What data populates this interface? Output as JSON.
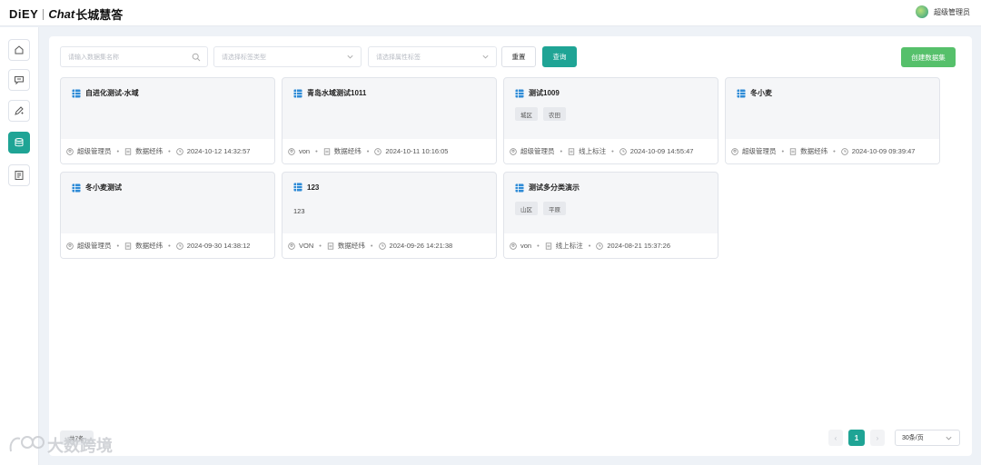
{
  "app": {
    "logo_brand": "DiEY",
    "logo_chat": "Chat",
    "logo_cn": "长城慧答",
    "user_name": "超级管理员"
  },
  "filters": {
    "search_placeholder": "请输入数据集名称",
    "type_placeholder": "请选择标签类型",
    "attr_placeholder": "请选择属性标签",
    "reset_label": "重置",
    "query_label": "查询",
    "create_label": "创建数据集"
  },
  "cards": [
    {
      "title": "自进化测试-水域",
      "desc": "",
      "tags": [],
      "user": "超级管理员",
      "source": "数据经纬",
      "time": "2024-10-12 14:32:57"
    },
    {
      "title": "青岛水域测试1011",
      "desc": "",
      "tags": [],
      "user": "von",
      "source": "数据经纬",
      "time": "2024-10-11 10:16:05"
    },
    {
      "title": "测试1009",
      "desc": "",
      "tags": [
        "城区",
        "农田"
      ],
      "user": "超级管理员",
      "source": "线上标注",
      "time": "2024-10-09 14:55:47"
    },
    {
      "title": "冬小麦",
      "desc": "",
      "tags": [],
      "user": "超级管理员",
      "source": "数据经纬",
      "time": "2024-10-09 09:39:47"
    },
    {
      "title": "冬小麦测试",
      "desc": "",
      "tags": [],
      "user": "超级管理员",
      "source": "数据经纬",
      "time": "2024-09-30 14:38:12"
    },
    {
      "title": "123",
      "desc": "123",
      "tags": [],
      "user": "VON",
      "source": "数据经纬",
      "time": "2024-09-26 14:21:38"
    },
    {
      "title": "测试多分类演示",
      "desc": "",
      "tags": [
        "山区",
        "平原"
      ],
      "user": "von",
      "source": "线上标注",
      "time": "2024-08-21 15:37:26"
    }
  ],
  "pagination": {
    "total_label": "共7条",
    "current_page": "1",
    "page_size": "30条/页",
    "prev": "‹",
    "next": "›"
  },
  "watermark": "大数跨境",
  "colors": {
    "accent": "#1fa495",
    "create": "#56c06b"
  }
}
